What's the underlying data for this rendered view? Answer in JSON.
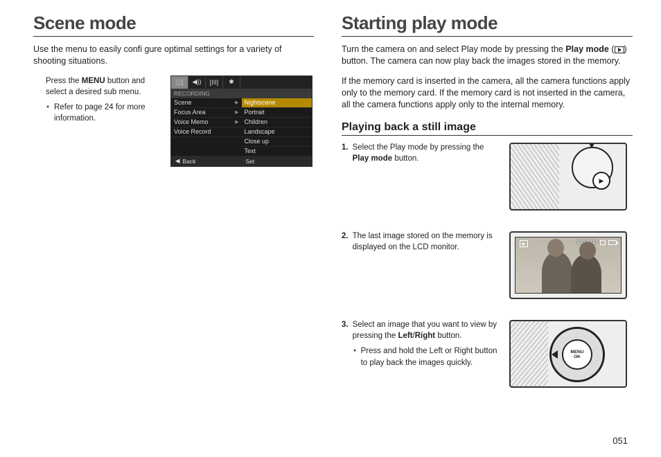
{
  "left": {
    "heading": "Scene mode",
    "intro": "Use the menu to easily confi gure optimal settings for a variety of shooting situations.",
    "instruction_pre": "Press the ",
    "instruction_bold": "MENU",
    "instruction_post": " button and select a desired sub menu.",
    "note": "Refer to page 24 for more information.",
    "menu": {
      "section_label": "RECORDING",
      "left_items": [
        "Scene",
        "Focus Area",
        "Voice Memo",
        "Voice Record"
      ],
      "right_items": [
        "Nightscene",
        "Portrait",
        "Children",
        "Landscape",
        "Close up",
        "Text"
      ],
      "back_label": "Back",
      "set_label": "Set"
    }
  },
  "right": {
    "heading": "Starting play mode",
    "intro_1a": "Turn the camera on and select Play mode by pressing the ",
    "intro_1b": "Play mode",
    "intro_1c": " (",
    "intro_1d": ") button. The camera can now play back the images stored in the memory.",
    "intro_2": "If the memory card is inserted in the camera, all the camera functions apply only to the memory card. If the memory card is not inserted in the camera, all the camera functions apply only to the internal memory.",
    "subheading": "Playing back a still image",
    "steps": [
      {
        "num": "1.",
        "text_a": "Select the Play mode by pressing the ",
        "text_b": "Play mode",
        "text_c": " button."
      },
      {
        "num": "2.",
        "text_a": "The last image stored on the memory is displayed on the LCD monitor.",
        "text_b": "",
        "text_c": ""
      },
      {
        "num": "3.",
        "text_a": "Select an image that you want to view by pressing the ",
        "text_b": "Left",
        "text_slash": "/",
        "text_b2": "Right",
        "text_c": " button.",
        "note": "Press and hold the Left or Right button to play back the images quickly."
      }
    ],
    "lcd": {
      "counter": "100-0010",
      "inner_button": "MENU\nOK"
    }
  },
  "page_number": "051"
}
